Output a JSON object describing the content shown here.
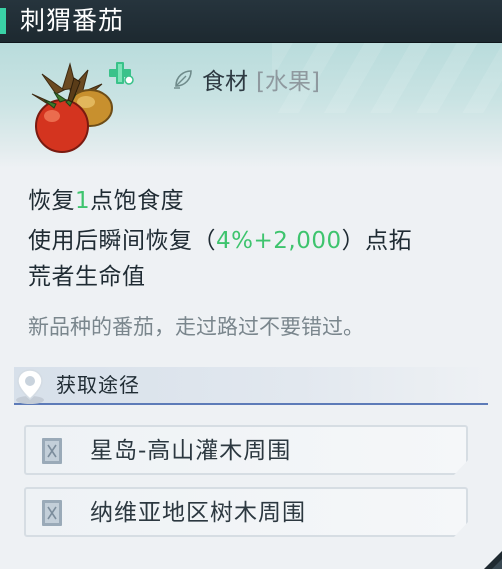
{
  "item": {
    "name": "刺猬番茄",
    "category": "食材",
    "subcategory": "[水果]"
  },
  "effects": {
    "line1_prefix": "恢复",
    "line1_value": "1",
    "line1_suffix": "点饱食度",
    "line2_prefix": "使用后瞬间恢复（",
    "line2_value": "4%+2,000",
    "line2_suffix": "）点拓",
    "line3": "荒者生命值"
  },
  "flavor_text": "新品种的番茄，走过路过不要错过。",
  "source": {
    "title": "获取途径",
    "locations": [
      {
        "label": "星岛-高山灌木周围",
        "icon": "map-scroll-icon"
      },
      {
        "label": "纳维亚地区树木周围",
        "icon": "map-scroll-icon"
      }
    ]
  },
  "colors": {
    "accent_green": "#3ec46e",
    "title_bar": "#26343d",
    "title_accent": "#3ad1a6",
    "source_underline": "#5d7bb8"
  },
  "icons": {
    "item": "hedgehog-tomato-icon",
    "badge": "plus-icon",
    "category": "leaf-icon",
    "source": "location-pin-icon"
  }
}
